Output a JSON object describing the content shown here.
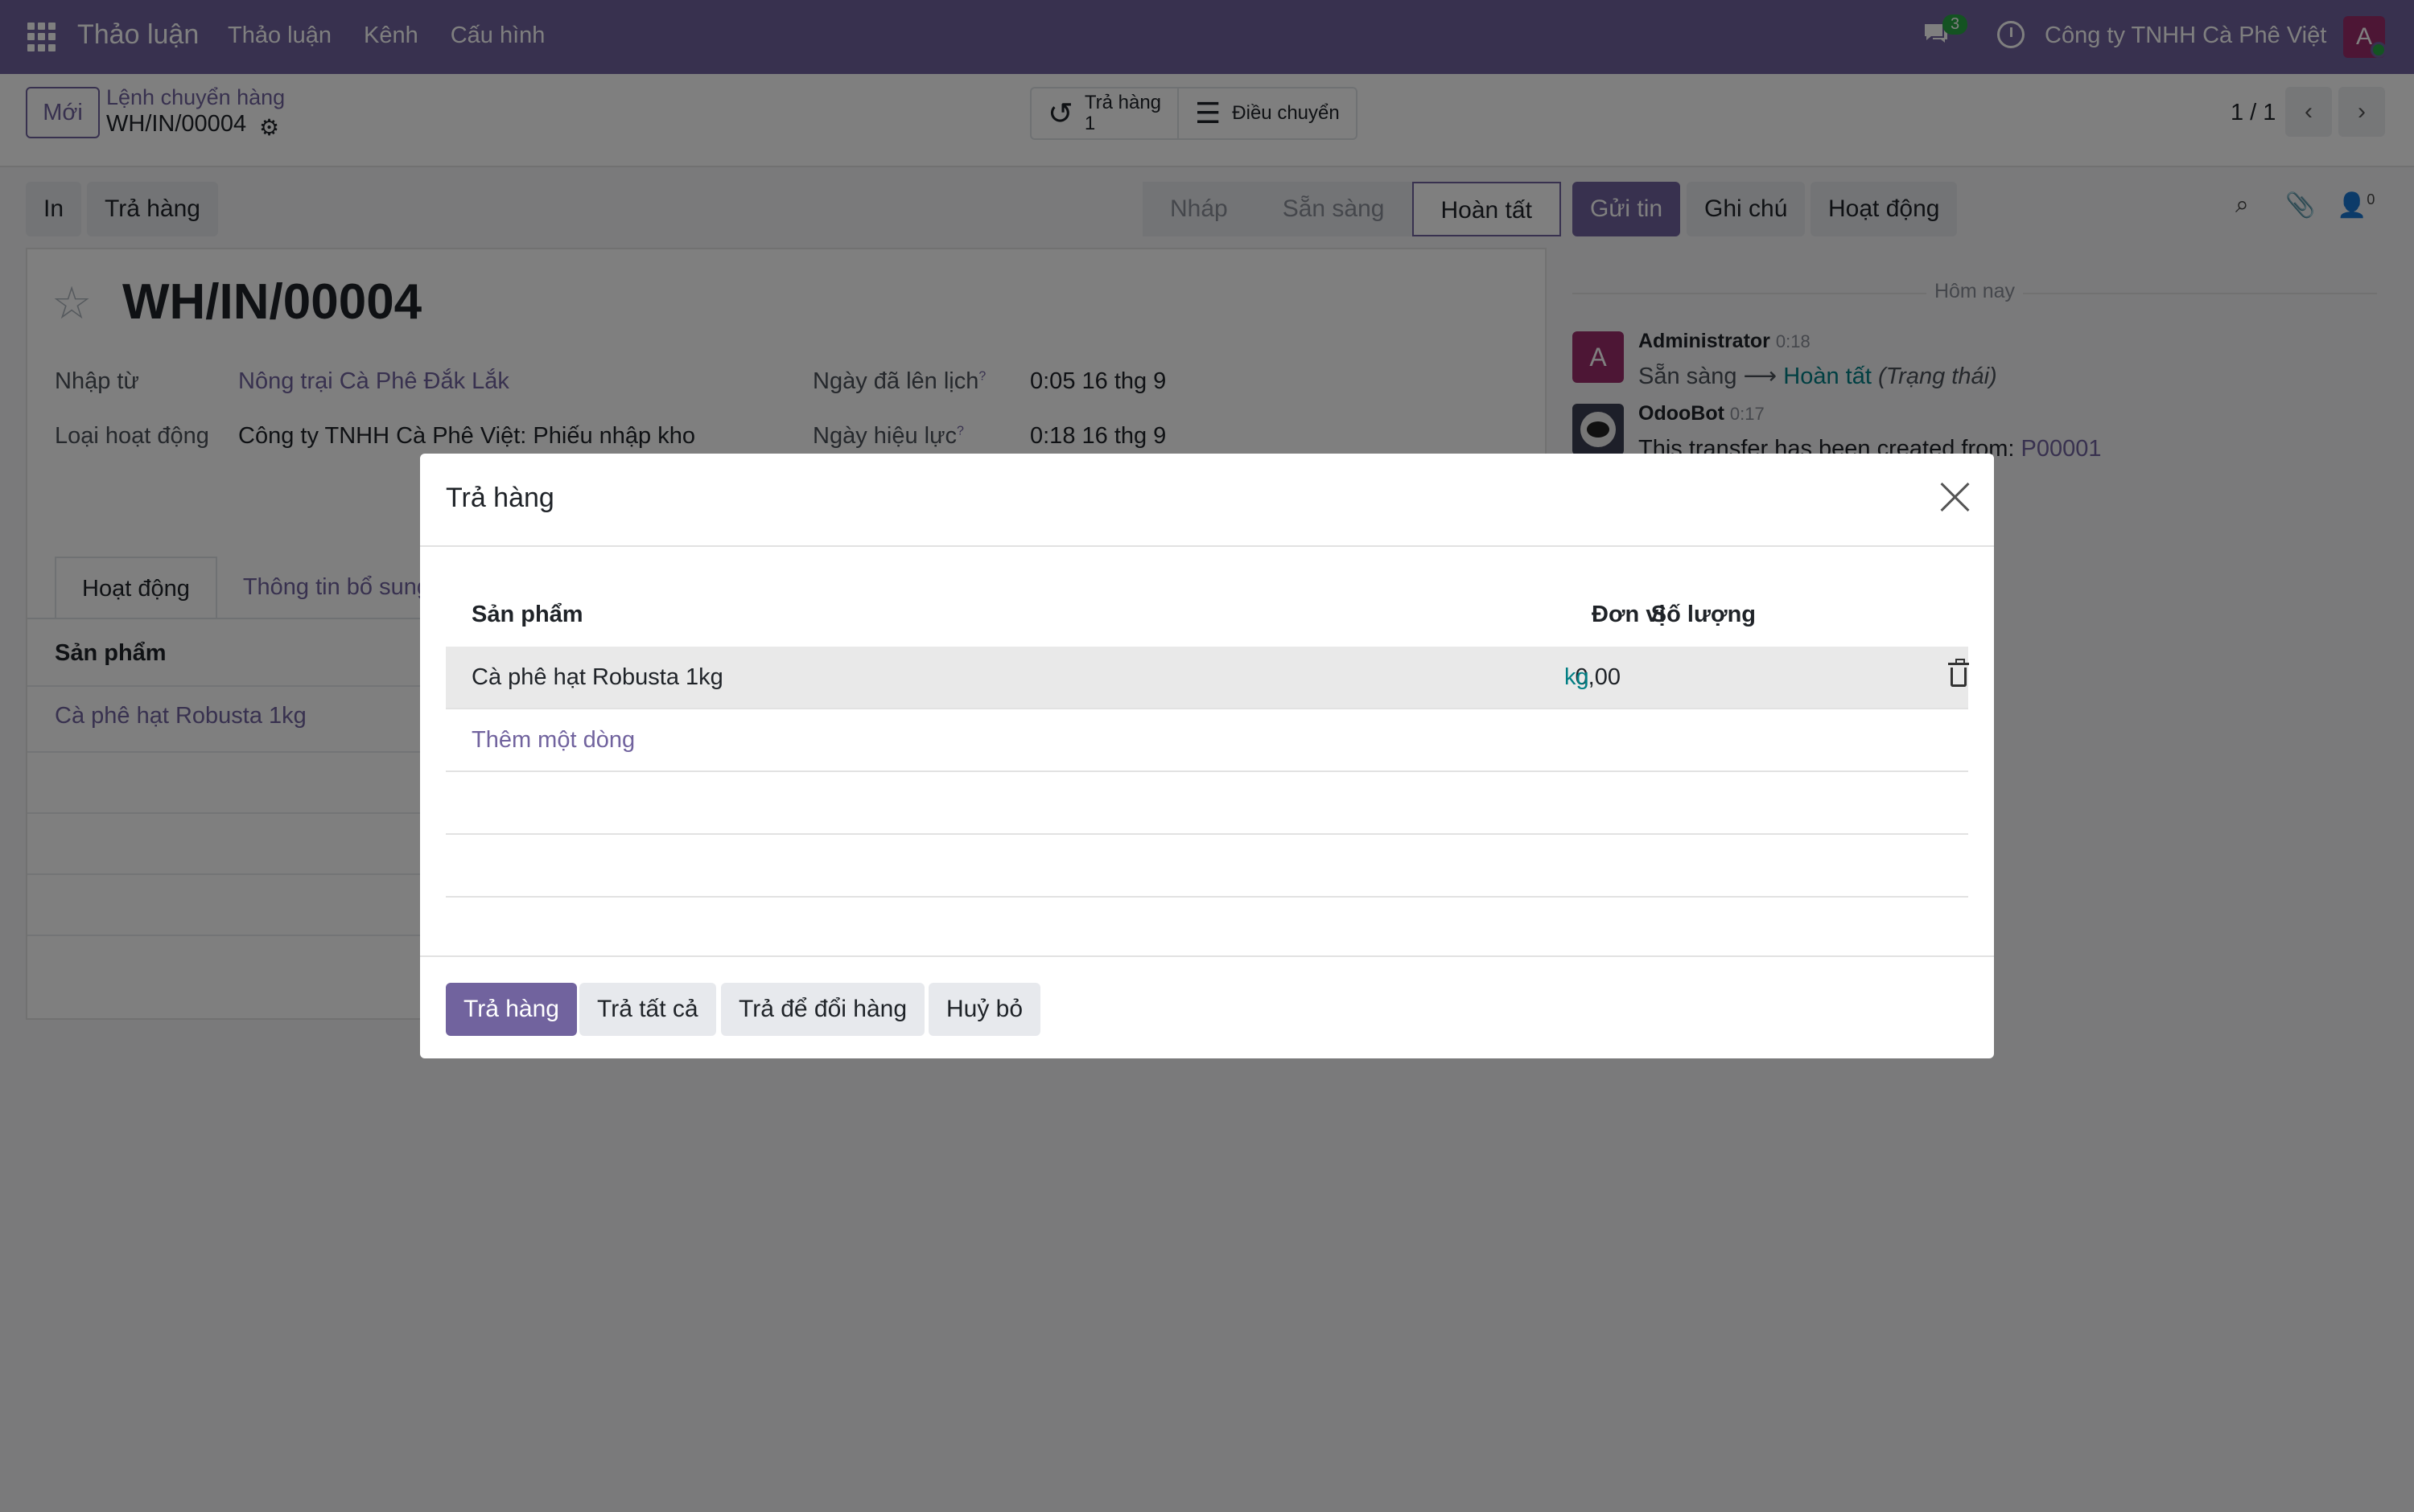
{
  "topbar": {
    "brand": "Thảo luận",
    "menu": [
      "Thảo luận",
      "Kênh",
      "Cấu hình"
    ],
    "chat_count": "3",
    "company": "Công ty TNHH Cà Phê Việt",
    "avatar_letter": "A"
  },
  "control_panel": {
    "new_label": "Mới",
    "breadcrumb_parent": "Lệnh chuyển hàng",
    "breadcrumb_current": "WH/IN/00004",
    "smart_return_label": "Trả hàng",
    "smart_return_count": "1",
    "smart_moves_label": "Điều chuyển",
    "pager": "1 / 1"
  },
  "form": {
    "buttons": {
      "print": "In",
      "return": "Trả hàng"
    },
    "states": [
      "Nháp",
      "Sẵn sàng",
      "Hoàn tất"
    ],
    "active_state": "Hoàn tất",
    "record_name": "WH/IN/00004",
    "fields": {
      "source_label": "Nhập từ",
      "source_value": "Nông trại Cà Phê Đắk Lắk",
      "op_type_label": "Loại hoạt động",
      "op_type_value": "Công ty TNHH Cà Phê Việt: Phiếu nhập kho",
      "scheduled_label": "Ngày đã lên lịch",
      "scheduled_value": "0:05 16 thg 9",
      "effective_label": "Ngày hiệu lực",
      "effective_value": "0:18 16 thg 9",
      "help_mark": "?"
    },
    "tabs": [
      "Hoạt động",
      "Thông tin bổ sung"
    ],
    "table_header": "Sản phẩm",
    "product_row": "Cà phê hạt Robusta 1kg"
  },
  "chatter": {
    "send_label": "Gửi tin",
    "note_label": "Ghi chú",
    "activity_label": "Hoạt động",
    "follower_count": "0",
    "today": "Hôm nay",
    "messages": [
      {
        "author": "Administrator",
        "time": "0:18",
        "avatar": "A",
        "from": "Sẵn sàng",
        "arrow": "⟶",
        "to": "Hoàn tất",
        "field": "(Trạng thái)"
      },
      {
        "author": "OdooBot",
        "time": "0:17",
        "text": "This transfer has been created from:",
        "link": "P00001"
      }
    ]
  },
  "modal": {
    "title": "Trả hàng",
    "columns": {
      "product": "Sản phẩm",
      "qty": "Số lượng",
      "uom": "Đơn vị"
    },
    "rows": [
      {
        "product": "Cà phê hạt Robusta 1kg",
        "qty": "0,00",
        "uom": "kg"
      }
    ],
    "add_line": "Thêm một dòng",
    "buttons": {
      "return": "Trả hàng",
      "return_all": "Trả tất cả",
      "exchange": "Trả để đổi hàng",
      "cancel": "Huỷ bỏ"
    }
  },
  "colors": {
    "brand": "#71639e",
    "success": "#28a745"
  }
}
